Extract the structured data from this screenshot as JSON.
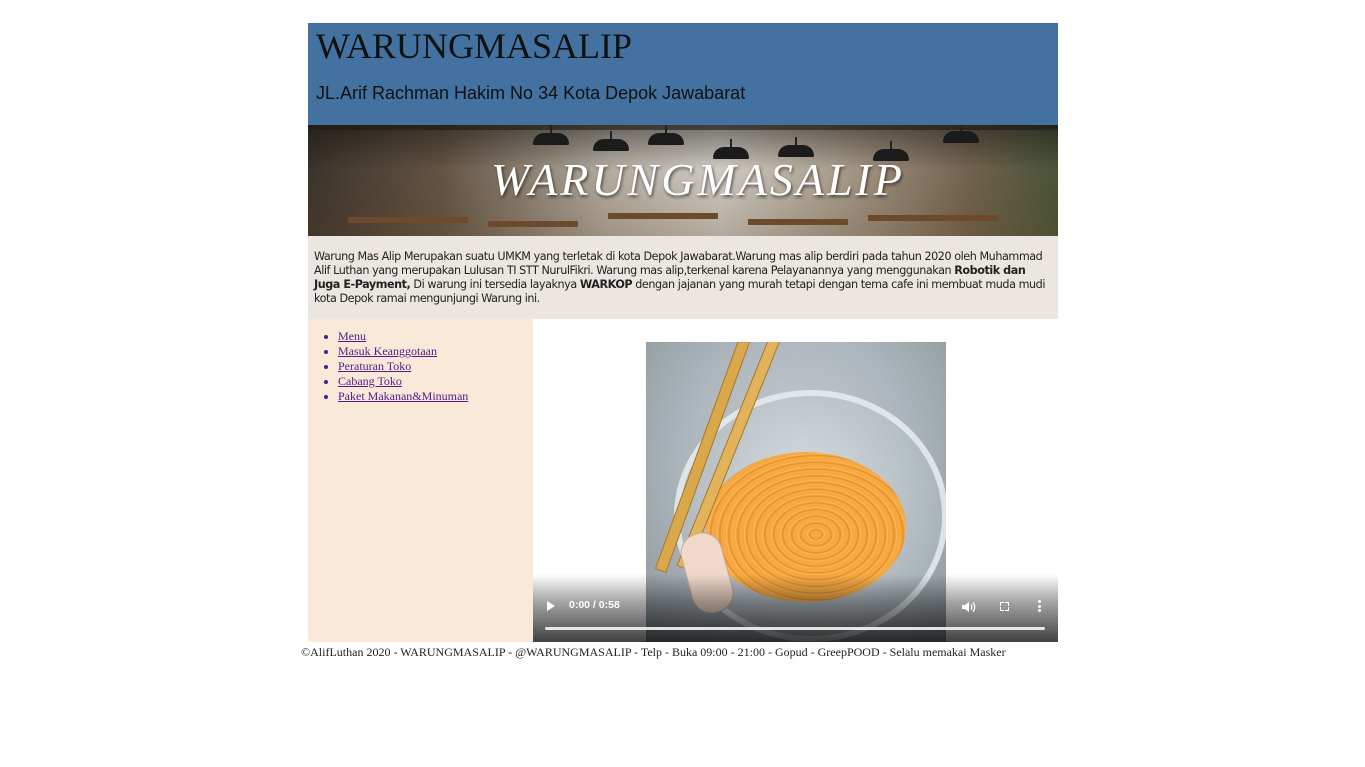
{
  "header": {
    "title": "WARUNGMASALIP",
    "address": "JL.Arif Rachman Hakim No 34 Kota Depok Jawabarat"
  },
  "banner": {
    "text": "WARUNGMASALIP"
  },
  "description": {
    "part1": "Warung Mas Alip Merupakan suatu UMKM yang terletak di kota Depok Jawabarat.Warung mas alip berdiri pada tahun 2020 oleh Muhammad Alif Luthan yang merupakan Lulusan TI STT NurulFikri. Warung mas alip,terkenal karena Pelayanannya yang menggunakan ",
    "bold1": "Robotik dan Juga E-Payment,",
    "part2": " Di warung ini tersedia layaknya ",
    "bold2": "WARKOP",
    "part3": " dengan jajanan yang murah tetapi dengan tema cafe ini membuat muda mudi kota Depok ramai mengunjungi Warung ini."
  },
  "sidebar": {
    "items": [
      {
        "label": "Menu"
      },
      {
        "label": "Masuk Keanggotaan"
      },
      {
        "label": "Peraturan Toko"
      },
      {
        "label": "Cabang Toko"
      },
      {
        "label": "Paket Makanan&Minuman"
      }
    ]
  },
  "video": {
    "time": "0:00 / 0:58",
    "progress_fraction": 0,
    "icons": [
      "play-icon",
      "volume-icon",
      "fullscreen-icon",
      "more-options-icon"
    ]
  },
  "footer": {
    "text": "©AlifLuthan 2020 - WARUNGMASALIP - @WARUNGMASALIP - Telp - Buka 09:00 - 21:00 - Gopud - GreepPOOD - Selalu memakai Masker"
  },
  "colors": {
    "header_bg": "#4472a0",
    "description_bg": "#ebe6e0",
    "sidebar_bg": "#f8e9d8",
    "link": "#551a8b"
  }
}
